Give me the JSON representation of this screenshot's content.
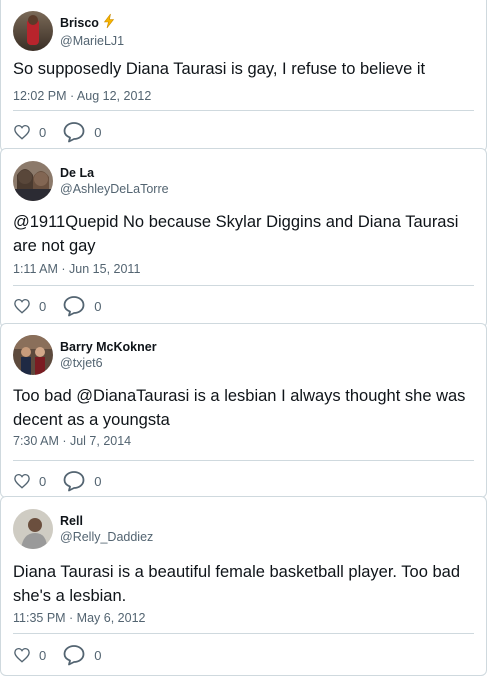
{
  "colors": {
    "text_primary": "#0f1419",
    "text_secondary": "#536471",
    "border": "#cfd9de",
    "bolt": "#f7b500"
  },
  "tweets": [
    {
      "display_name": "Brisco",
      "badge_icon": "lightning-bolt-icon",
      "handle": "@MarieLJ1",
      "text": "So supposedly Diana Taurasi is gay, I refuse to believe it",
      "timestamp": "12:02 PM · Aug 12, 2012",
      "likes": "0",
      "replies": "0"
    },
    {
      "display_name": "De La",
      "handle": "@AshleyDeLaTorre",
      "text": "@1911Quepid No because Skylar Diggins and Diana Taurasi are not gay",
      "timestamp": "1:11 AM · Jun 15, 2011",
      "likes": "0",
      "replies": "0"
    },
    {
      "display_name": "Barry McKokner",
      "handle": "@txjet6",
      "text": "Too bad @DianaTaurasi is a lesbian I always thought she was decent as a youngsta",
      "timestamp": "7:30 AM · Jul 7, 2014",
      "likes": "0",
      "replies": "0"
    },
    {
      "display_name": "Rell",
      "handle": "@Relly_Daddiez",
      "text": "Diana Taurasi is a beautiful female basketball player. Too bad she's a lesbian.",
      "timestamp": "11:35 PM · May 6, 2012",
      "likes": "0",
      "replies": "0"
    }
  ]
}
